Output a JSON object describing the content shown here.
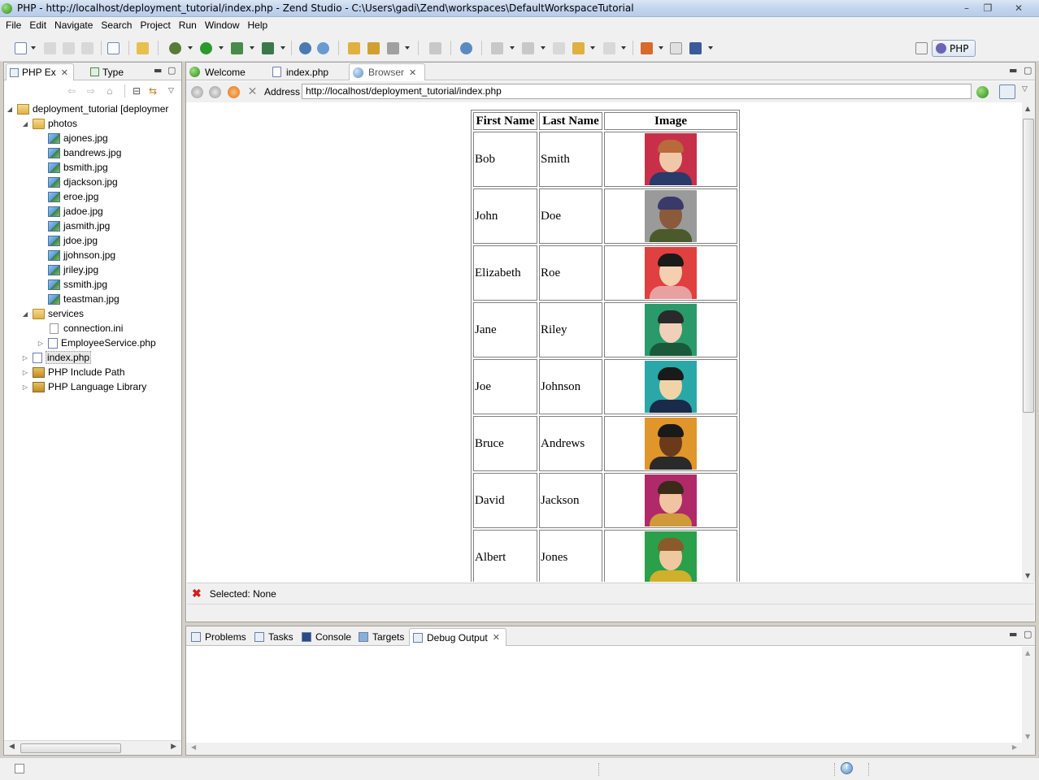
{
  "window": {
    "title": "PHP - http://localhost/deployment_tutorial/index.php - Zend Studio - C:\\Users\\gadi\\Zend\\workspaces\\DefaultWorkspaceTutorial",
    "minimize_glyph": "–",
    "maximize_glyph": "❐",
    "close_glyph": "✕"
  },
  "menu": [
    "File",
    "Edit",
    "Navigate",
    "Search",
    "Project",
    "Run",
    "Window",
    "Help"
  ],
  "perspective": {
    "label": "PHP"
  },
  "left_panel": {
    "tabs": [
      {
        "label": "PHP Ex",
        "icon": "php-explorer-icon",
        "active": true
      },
      {
        "label": "Type",
        "icon": "type-hierarchy-icon",
        "active": false
      }
    ],
    "tree": [
      {
        "label": "deployment_tutorial [deploymer",
        "icon": "project-icon",
        "expanded": true,
        "depth": 0
      },
      {
        "label": "photos",
        "icon": "folder-icon",
        "expanded": true,
        "depth": 1
      },
      {
        "label": "ajones.jpg",
        "icon": "image-file-icon",
        "depth": 2
      },
      {
        "label": "bandrews.jpg",
        "icon": "image-file-icon",
        "depth": 2
      },
      {
        "label": "bsmith.jpg",
        "icon": "image-file-icon",
        "depth": 2
      },
      {
        "label": "djackson.jpg",
        "icon": "image-file-icon",
        "depth": 2
      },
      {
        "label": "eroe.jpg",
        "icon": "image-file-icon",
        "depth": 2
      },
      {
        "label": "jadoe.jpg",
        "icon": "image-file-icon",
        "depth": 2
      },
      {
        "label": "jasmith.jpg",
        "icon": "image-file-icon",
        "depth": 2
      },
      {
        "label": "jdoe.jpg",
        "icon": "image-file-icon",
        "depth": 2
      },
      {
        "label": "jjohnson.jpg",
        "icon": "image-file-icon",
        "depth": 2
      },
      {
        "label": "jriley.jpg",
        "icon": "image-file-icon",
        "depth": 2
      },
      {
        "label": "ssmith.jpg",
        "icon": "image-file-icon",
        "depth": 2
      },
      {
        "label": "teastman.jpg",
        "icon": "image-file-icon",
        "depth": 2
      },
      {
        "label": "services",
        "icon": "folder-icon",
        "expanded": true,
        "depth": 1
      },
      {
        "label": "connection.ini",
        "icon": "ini-file-icon",
        "depth": 2
      },
      {
        "label": "EmployeeService.php",
        "icon": "php-file-icon",
        "expanded": false,
        "depth": 2
      },
      {
        "label": "index.php",
        "icon": "php-file-icon",
        "expanded": false,
        "depth": 1,
        "selected": true
      },
      {
        "label": "PHP Include Path",
        "icon": "library-icon",
        "expanded": false,
        "depth": 1
      },
      {
        "label": "PHP Language Library",
        "icon": "library-icon",
        "expanded": false,
        "depth": 1
      }
    ]
  },
  "editor": {
    "tabs": [
      {
        "label": "Welcome",
        "icon": "welcome-icon",
        "active": false
      },
      {
        "label": "index.php",
        "icon": "php-file-icon",
        "active": false
      },
      {
        "label": "Browser",
        "icon": "globe-icon",
        "active": true
      }
    ],
    "browser": {
      "address_label": "Address",
      "address_value": "http://localhost/deployment_tutorial/index.php",
      "table": {
        "headers": [
          "First Name",
          "Last Name",
          "Image"
        ],
        "rows": [
          {
            "first": "Bob",
            "last": "Smith",
            "bg": "#c8304a",
            "skin": "#f0c8a8",
            "hair": "#b86a3a",
            "shirt": "#2a3a6a"
          },
          {
            "first": "John",
            "last": "Doe",
            "bg": "#9a9a9a",
            "skin": "#8a5a3a",
            "hair": "#3a3a6a",
            "shirt": "#4a5a2a"
          },
          {
            "first": "Elizabeth",
            "last": "Roe",
            "bg": "#e04040",
            "skin": "#f4d0b0",
            "hair": "#1a1a1a",
            "shirt": "#e8a0a0"
          },
          {
            "first": "Jane",
            "last": "Riley",
            "bg": "#2a9a6a",
            "skin": "#f0d0b8",
            "hair": "#2a2a2a",
            "shirt": "#1a5a3a"
          },
          {
            "first": "Joe",
            "last": "Johnson",
            "bg": "#2aa8a8",
            "skin": "#f0d4a8",
            "hair": "#1a1a1a",
            "shirt": "#1a2a4a"
          },
          {
            "first": "Bruce",
            "last": "Andrews",
            "bg": "#e0962a",
            "skin": "#6a3a1a",
            "hair": "#1a1a1a",
            "shirt": "#2a2a2a"
          },
          {
            "first": "David",
            "last": "Jackson",
            "bg": "#b02a6a",
            "skin": "#f0c4a0",
            "hair": "#3a2a1a",
            "shirt": "#d09a3a"
          },
          {
            "first": "Albert",
            "last": "Jones",
            "bg": "#2aa04a",
            "skin": "#f0c8a0",
            "hair": "#8a5a2a",
            "shirt": "#d0b02a"
          }
        ]
      },
      "status": "Selected: None"
    }
  },
  "bottom_panel": {
    "tabs": [
      {
        "label": "Problems",
        "icon": "problems-icon",
        "active": false
      },
      {
        "label": "Tasks",
        "icon": "tasks-icon",
        "active": false
      },
      {
        "label": "Console",
        "icon": "console-icon",
        "active": false
      },
      {
        "label": "Targets",
        "icon": "targets-icon",
        "active": false
      },
      {
        "label": "Debug Output",
        "icon": "debug-output-icon",
        "active": true
      }
    ]
  },
  "colors": {
    "title_gradient_top": "#dbe6f4",
    "selected_row": "#e8e8e8",
    "error_red": "#d02020"
  }
}
